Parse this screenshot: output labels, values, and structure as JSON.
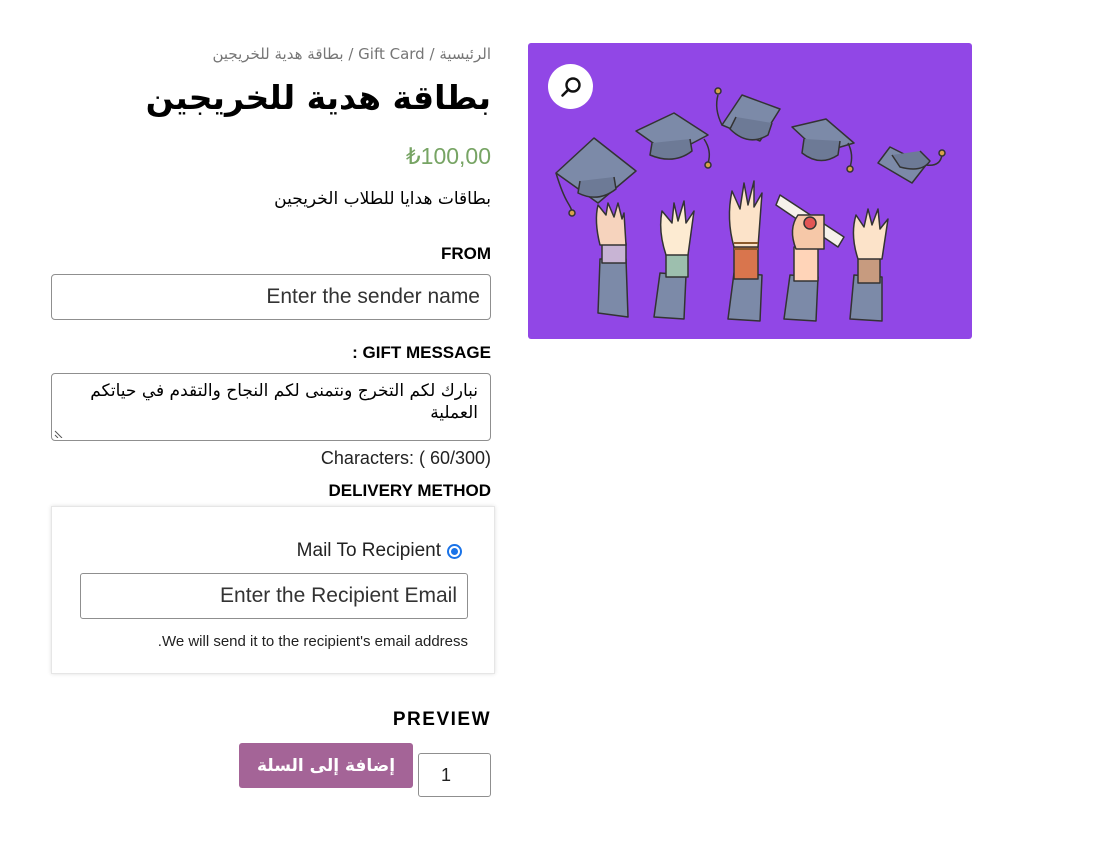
{
  "breadcrumb": {
    "home": "الرئيسية",
    "separator": "/",
    "category": "Gift Card",
    "current": "بطاقة هدية للخريجين"
  },
  "product": {
    "title": "بطاقة هدية للخريجين",
    "price": "₺100,00",
    "short_description": "بطاقات هدايا للطلاب الخريجين"
  },
  "form": {
    "from_label": "FROM",
    "from_placeholder": "Enter the sender name",
    "message_label": "GIFT MESSAGE :",
    "message_value": "نبارك لكم التخرج ونتمنى لكم النجاح والتقدم في حياتكم العملية",
    "char_count": "Characters: ( 60/300)",
    "delivery_label": "DELIVERY METHOD",
    "delivery_option": "Mail To Recipient",
    "recipient_placeholder": "Enter the Recipient Email",
    "delivery_note": "We will send it to the recipient's email address.",
    "preview_label": "PREVIEW",
    "quantity": "1",
    "add_to_cart": "إضافة إلى السلة"
  },
  "colors": {
    "price": "#77a464",
    "button": "#a46497",
    "gallery_bg": "#9147e6",
    "radio": "#1a73e8"
  },
  "icons": {
    "zoom": "magnifier-icon"
  }
}
